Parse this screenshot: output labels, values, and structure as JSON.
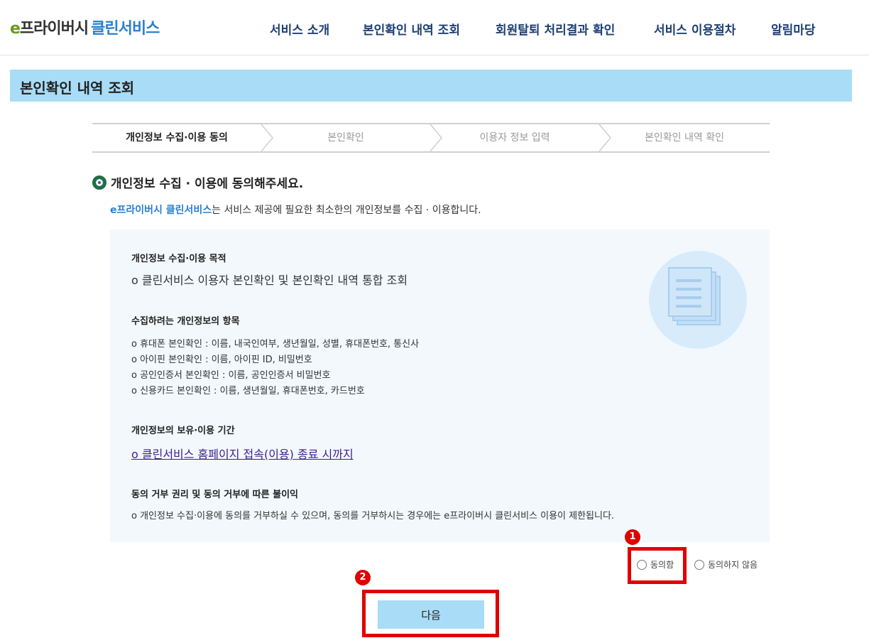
{
  "header": {
    "logo_e": "e",
    "logo_privacy": "프라이버시",
    "logo_clean": "클린서비스",
    "nav": [
      "서비스 소개",
      "본인확인 내역 조회",
      "회원탈퇴 처리결과 확인",
      "서비스 이용절차",
      "알림마당"
    ]
  },
  "page_title": "본인확인 내역 조회",
  "steps": [
    "개인정보 수집·이용 동의",
    "본인확인",
    "이용자 정보 입력",
    "본인확인 내역 확인"
  ],
  "section_title": "개인정보 수집 · 이용에 동의해주세요.",
  "intro": {
    "brand": "e프라이버시 클린서비스",
    "text": "는 서비스 제공에 필요한 최소한의 개인정보를 수집 · 이용합니다."
  },
  "info": {
    "purpose_heading": "개인정보 수집·이용 목적",
    "purpose_text": "o 클린서비스 이용자 본인확인 및 본인확인 내역 통합 조회",
    "items_heading": "수집하려는 개인정보의 항목",
    "items": [
      "o 휴대폰 본인확인 : 이름, 내국인여부, 생년월일, 성별, 휴대폰번호, 통신사",
      "o 아이핀 본인확인 : 이름, 아이핀 ID, 비밀번호",
      "o 공인인증서 본인확인 : 이름, 공인인증서 비밀번호",
      "o 신용카드 본인확인 : 이름, 생년월일, 휴대폰번호, 카드번호"
    ],
    "retention_heading": "개인정보의 보유·이용 기간",
    "retention_text": "o 클린서비스 홈페이지 접속(이용) 종료 시까지",
    "refusal_heading": "동의 거부 권리 및 동의 거부에 따른 불이익",
    "refusal_text": "o 개인정보 수집·이용에 동의를 거부하실 수 있으며, 동의를 거부하시는 경우에는 e프라이버시 클린서비스 이용이 제한됩니다."
  },
  "consent": {
    "agree_label": "동의함",
    "disagree_label": "동의하지 않음"
  },
  "badges": [
    "1",
    "2"
  ],
  "next_button": "다음",
  "colors": {
    "accent_light_blue": "#a9dcf7",
    "nav_navy": "#1d3f73",
    "brand_blue": "#2a7fcf",
    "highlight_red": "#e00000",
    "info_bg": "#f3f8fd"
  },
  "icons": [
    "document-icon",
    "step-chevron-icon",
    "bullet-dot-icon"
  ]
}
